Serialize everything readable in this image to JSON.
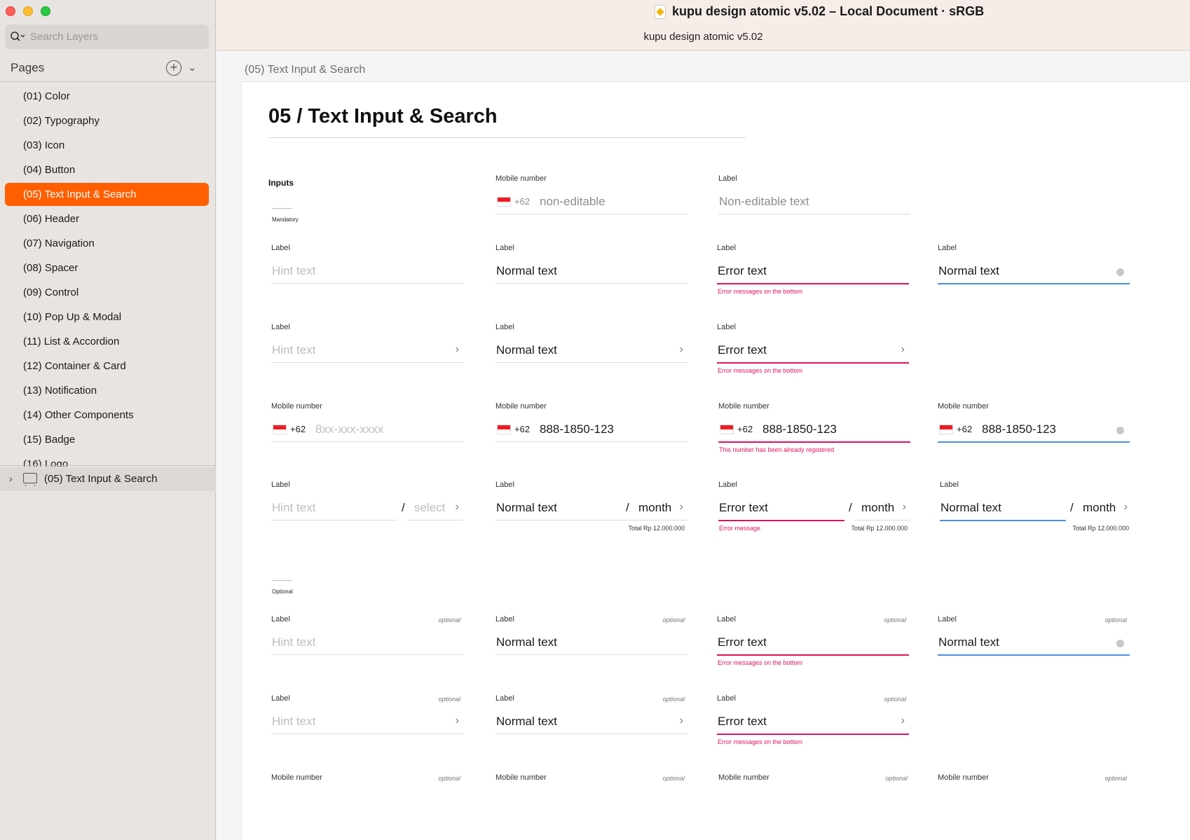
{
  "sidebar": {
    "search_placeholder": "Search Layers",
    "pages_header": "Pages",
    "pages": [
      "(01) Color",
      "(02) Typography",
      "(03) Icon",
      "(04) Button",
      "(05) Text Input & Search",
      "(06) Header",
      "(07) Navigation",
      "(08) Spacer",
      "(09) Control",
      "(10) Pop Up & Modal",
      "(11) List & Accordion",
      "(12) Container & Card",
      "(13) Notification",
      "(14) Other Components",
      "(15) Badge",
      "(16) Logo"
    ],
    "active_page": "(05) Text Input & Search",
    "layer": "(05) Text Input & Search"
  },
  "titlebar": {
    "title": "kupu design atomic v5.02 – Local Document · sRGB",
    "subtitle": "kupu design atomic v5.02"
  },
  "canvas": {
    "artboard_label": "(05) Text Input & Search",
    "heading": "05 / Text Input & Search",
    "section_inputs": "Inputs",
    "tag_mandatory": "Mandatory",
    "tag_optional": "Optional"
  },
  "fields": {
    "label": "Label",
    "mobile_label": "Mobile number",
    "hint": "Hint text",
    "normal": "Normal text",
    "error": "Error text",
    "error_msg_bottom": "Error messages on the bottom",
    "error_msg_registered": "This number has been already registered",
    "error_msg": "Error message",
    "non_editable_text": "Non-editable text",
    "non_editable": "non-editable",
    "country_code": "+62",
    "phone_hint": "8xx-xxx-xxxx",
    "phone_value": "888-1850-123",
    "slash": "/",
    "select": "select",
    "month": "month",
    "total": "Total Rp 12.000.000",
    "optional": "optional",
    "chevron": "›"
  },
  "colors": {
    "accent": "#ff5f00",
    "error": "#e0115f",
    "focus": "#4d8fe0"
  }
}
